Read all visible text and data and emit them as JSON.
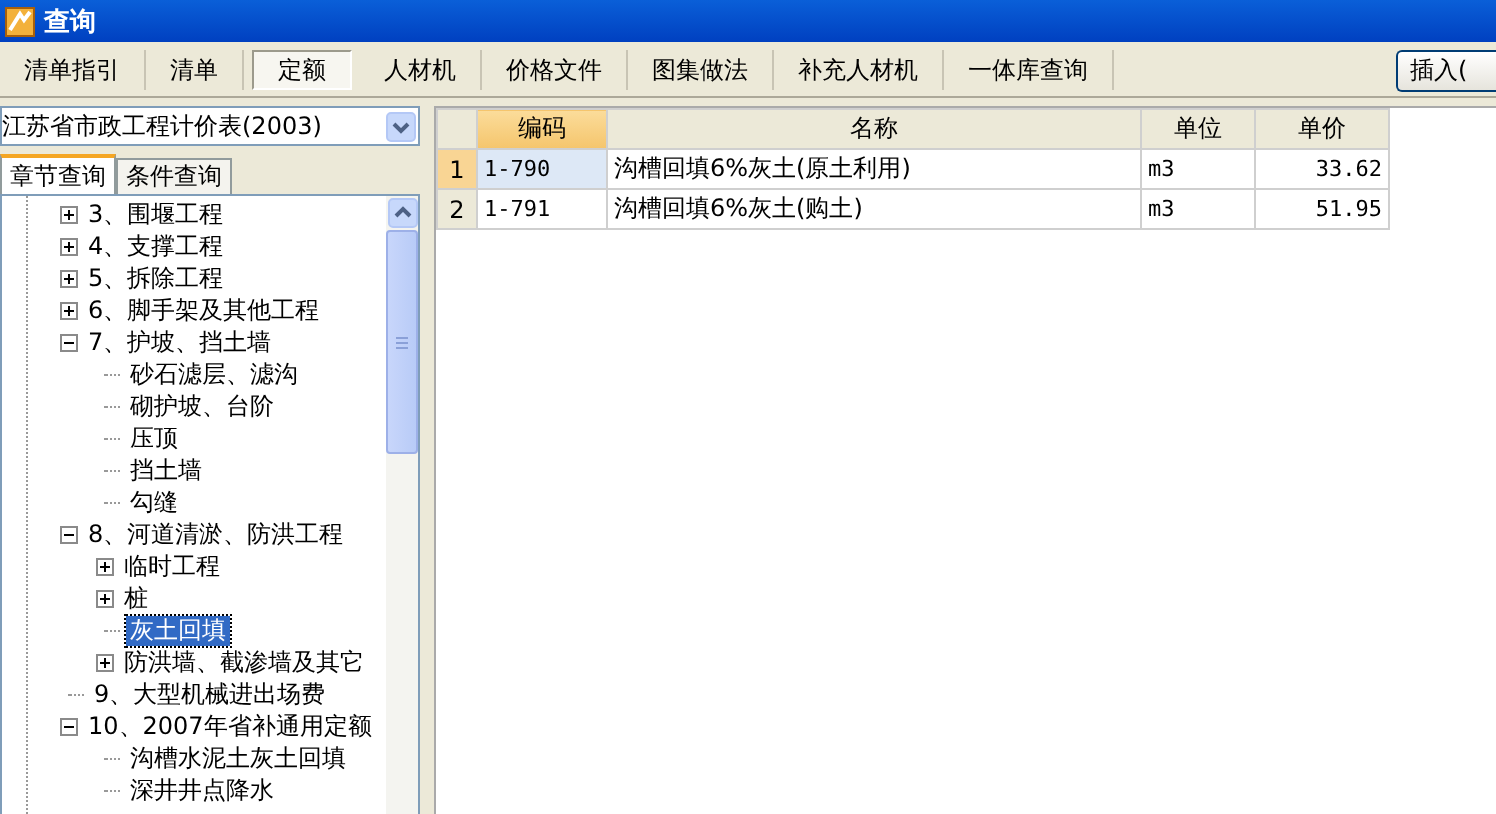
{
  "window": {
    "title": "查询"
  },
  "tabs": [
    {
      "label": "清单指引",
      "selected": false
    },
    {
      "label": "清单",
      "selected": false
    },
    {
      "label": "定额",
      "selected": true
    },
    {
      "label": "人材机",
      "selected": false
    },
    {
      "label": "价格文件",
      "selected": false
    },
    {
      "label": "图集做法",
      "selected": false
    },
    {
      "label": "补充人材机",
      "selected": false
    },
    {
      "label": "一体库查询",
      "selected": false
    }
  ],
  "insert_button": "插入(",
  "library_select": {
    "value": "江苏省市政工程计价表(2003)"
  },
  "sub_tabs": [
    {
      "label": "章节查询",
      "selected": true
    },
    {
      "label": "条件查询",
      "selected": false
    }
  ],
  "tree": [
    {
      "label": "3、围堰工程",
      "expanded": false,
      "selected": false
    },
    {
      "label": "4、支撑工程",
      "expanded": false,
      "selected": false
    },
    {
      "label": "5、拆除工程",
      "expanded": false,
      "selected": false
    },
    {
      "label": "6、脚手架及其他工程",
      "expanded": false,
      "selected": false
    },
    {
      "label": "7、护坡、挡土墙",
      "expanded": true,
      "selected": false,
      "children": [
        {
          "label": "砂石滤层、滤沟",
          "selected": false
        },
        {
          "label": "砌护坡、台阶",
          "selected": false
        },
        {
          "label": "压顶",
          "selected": false
        },
        {
          "label": "挡土墙",
          "selected": false
        },
        {
          "label": "勾缝",
          "selected": false
        }
      ]
    },
    {
      "label": "8、河道清淤、防洪工程",
      "expanded": true,
      "selected": false,
      "children": [
        {
          "label": "临时工程",
          "expanded": false,
          "selected": false
        },
        {
          "label": "桩",
          "expanded": false,
          "selected": false
        },
        {
          "label": "灰土回填",
          "selected": true
        },
        {
          "label": "防洪墙、截渗墙及其它",
          "expanded": false,
          "selected": false
        }
      ]
    },
    {
      "label": "9、大型机械进出场费",
      "selected": false
    },
    {
      "label": "10、2007年省补通用定额",
      "expanded": true,
      "selected": false,
      "children": [
        {
          "label": "沟槽水泥土灰土回填",
          "selected": false
        },
        {
          "label": "深井井点降水",
          "selected": false
        }
      ]
    }
  ],
  "table": {
    "columns": [
      "编码",
      "名称",
      "单位",
      "单价"
    ],
    "rows": [
      {
        "index": "1",
        "code": "1-790",
        "name": "沟槽回填6%灰土(原土利用)",
        "unit": "m3",
        "price": "33.62",
        "selected": true
      },
      {
        "index": "2",
        "code": "1-791",
        "name": "沟槽回填6%灰土(购土)",
        "unit": "m3",
        "price": "51.95",
        "selected": false
      }
    ]
  }
}
